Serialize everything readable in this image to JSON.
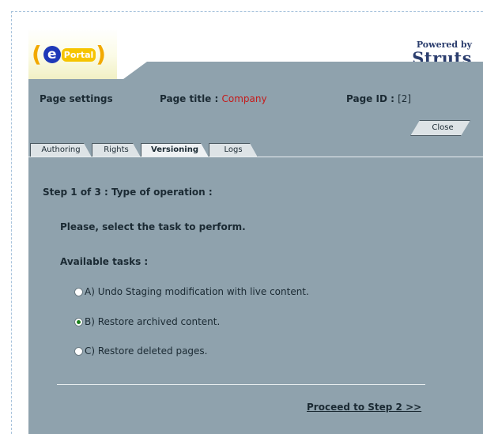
{
  "header": {
    "logo_e": "e",
    "logo_portal": "Portal",
    "powered_line1": "Powered by",
    "powered_line2": "Struts"
  },
  "page_settings": {
    "label": "Page settings",
    "title_label": "Page title : ",
    "title_value": "Company",
    "id_label": "Page ID : ",
    "id_value": "[2]"
  },
  "close_label": "Close",
  "tabs": [
    {
      "label": "Authoring",
      "active": false
    },
    {
      "label": "Rights",
      "active": false
    },
    {
      "label": "Versioning",
      "active": true
    },
    {
      "label": "Logs",
      "active": false
    }
  ],
  "step_title": "Step 1 of 3 : Type of operation :",
  "instruction": "Please, select the task to perform.",
  "available_label": "Available tasks :",
  "options": [
    {
      "label": "A) Undo Staging modification with live content.",
      "checked": false
    },
    {
      "label": "B) Restore archived content.",
      "checked": true
    },
    {
      "label": "C) Restore deleted pages.",
      "checked": false
    }
  ],
  "proceed_label": "Proceed to Step 2 >>"
}
